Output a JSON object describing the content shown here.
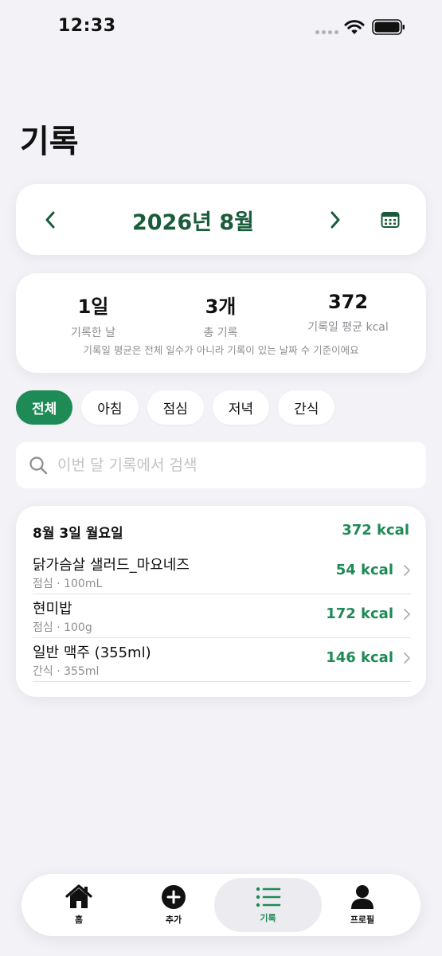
{
  "status_bar": {
    "time": "12:33"
  },
  "header": {
    "title": "기록"
  },
  "month_selector": {
    "label": "2026년 8월"
  },
  "stats": {
    "items": [
      {
        "value": "1일",
        "label": "기록한 날"
      },
      {
        "value": "3개",
        "label": "총 기록"
      },
      {
        "value": "372",
        "label": "기록일 평균 kcal"
      }
    ],
    "note": "기록일 평균은 전체 일수가 아니라 기록이 있는 날짜 수 기준이에요"
  },
  "filters": {
    "selected": "전체",
    "items": [
      "전체",
      "아침",
      "점심",
      "저녁",
      "간식"
    ]
  },
  "search": {
    "placeholder": "이번 달 기록에서 검색",
    "value": ""
  },
  "day_groups": [
    {
      "date": "8월 3일 월요일",
      "total": "372 kcal",
      "entries": [
        {
          "name": "닭가슴살 샐러드_마요네즈",
          "sub": "점심 · 100mL",
          "kcal": "54 kcal"
        },
        {
          "name": "현미밥",
          "sub": "점심 · 100g",
          "kcal": "172 kcal"
        },
        {
          "name": "일반 맥주 (355ml)",
          "sub": "간식 · 355ml",
          "kcal": "146 kcal"
        }
      ]
    }
  ],
  "tab_bar": {
    "active": "기록",
    "items": [
      {
        "label": "홈",
        "icon": "house-icon"
      },
      {
        "label": "추가",
        "icon": "plus-circle-icon"
      },
      {
        "label": "기록",
        "icon": "list-icon"
      },
      {
        "label": "프로필",
        "icon": "person-icon"
      }
    ]
  },
  "colors": {
    "accent": "#1e8a55",
    "month_text": "#1a5c3a",
    "background": "#f2f2f7",
    "secondary_text": "#8e8e93"
  }
}
